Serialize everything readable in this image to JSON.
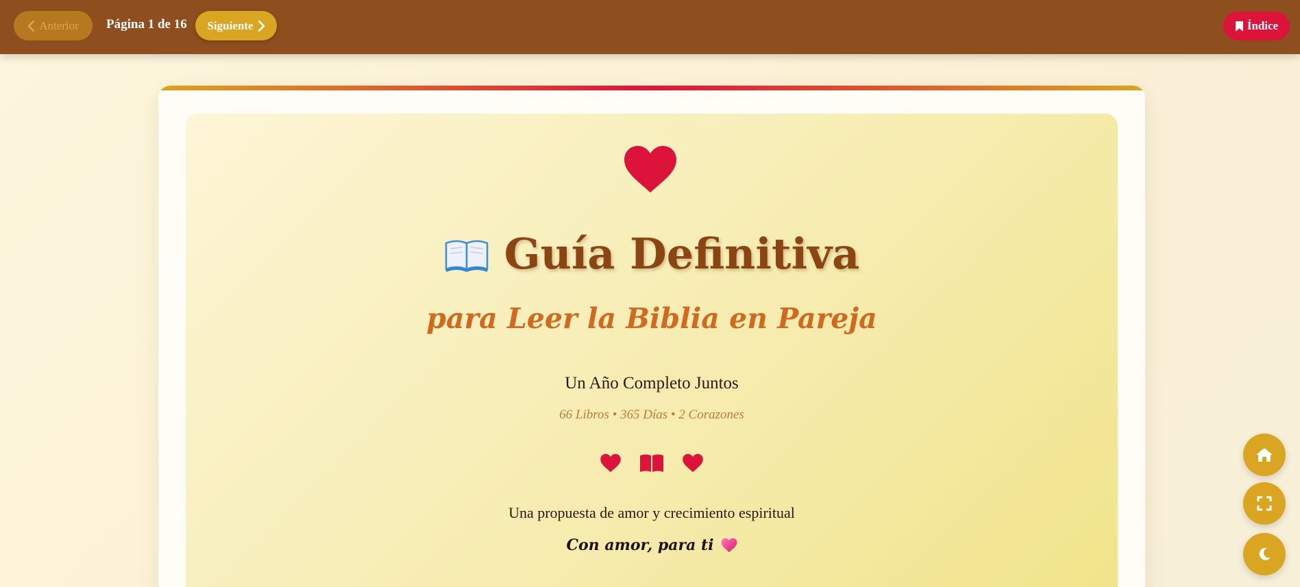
{
  "toolbar": {
    "prev_label": "Anterior",
    "page_indicator": "Página 1 de 16",
    "next_label": "Siguiente",
    "index_label": "Índice"
  },
  "cover": {
    "title": "Guía Definitiva",
    "subtitle": "para Leer la Biblia en Pareja",
    "tagline": "Un Año Completo Juntos",
    "meta": "66 Libros • 365 Días • 2 Corazones",
    "proposal": "Una propuesta de amor y crecimiento espiritual",
    "dedication": "Con amor, para ti"
  },
  "icons": {
    "top": "heart-icon",
    "title": "open-book-icon",
    "row": [
      "heart-icon",
      "book-icon",
      "heart-icon"
    ],
    "dedication": "pink-heart-icon",
    "fabs": [
      "home-icon",
      "fullscreen-icon",
      "moon-icon"
    ]
  },
  "colors": {
    "topbar": "#8e4e1e",
    "accent_gold": "#daa520",
    "accent_red": "#dc143c",
    "title": "#8b4513",
    "subtitle": "#d2691e"
  }
}
